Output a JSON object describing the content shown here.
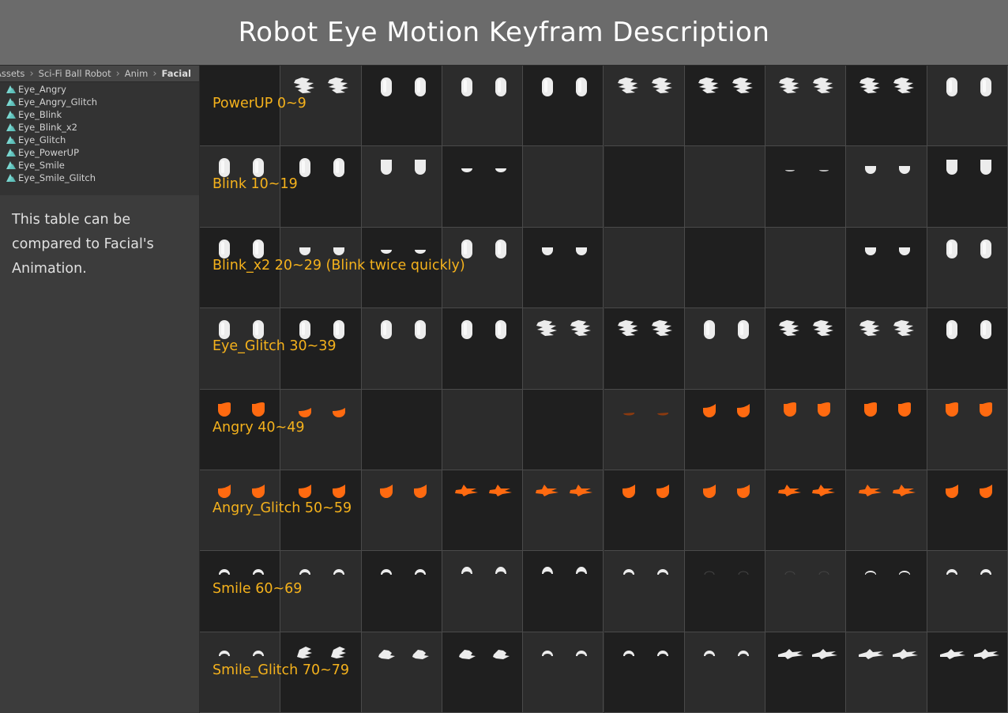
{
  "page": {
    "title": "Robot Eye Motion Keyfram Description"
  },
  "breadcrumb": [
    "Assets",
    "Sci-Fi Ball Robot",
    "Anim",
    "Facial"
  ],
  "files": [
    {
      "name": "Eye_Angry",
      "icon": "animation-clip-icon"
    },
    {
      "name": "Eye_Angry_Glitch",
      "icon": "animation-clip-icon"
    },
    {
      "name": "Eye_Blink",
      "icon": "animation-clip-icon"
    },
    {
      "name": "Eye_Blink_x2",
      "icon": "animation-clip-icon"
    },
    {
      "name": "Eye_Glitch",
      "icon": "animation-clip-icon"
    },
    {
      "name": "Eye_PowerUP",
      "icon": "animation-clip-icon"
    },
    {
      "name": "Eye_Smile",
      "icon": "animation-clip-icon"
    },
    {
      "name": "Eye_Smile_Glitch",
      "icon": "animation-clip-icon"
    }
  ],
  "note": "This table can be compared to Facial's Animation.",
  "colors": {
    "label": "#f5b21c",
    "eye_white": "#ececec",
    "eye_orange": "#ff6a10",
    "cell_dark": "#1f1f1f",
    "cell_light": "#2c2c2c",
    "title_bg": "#6b6b6b"
  },
  "rows": [
    {
      "label": "PowerUP 0~9",
      "frames": [
        "none",
        "glitch",
        "pill",
        "pill",
        "pill",
        "glitch",
        "glitch",
        "glitch",
        "glitch",
        "pill"
      ]
    },
    {
      "label": "Blink 10~19",
      "frames": [
        "pill",
        "pill",
        "pill_half",
        "slit",
        "none",
        "none",
        "none",
        "slit_thin",
        "pill_low",
        "pill_half"
      ]
    },
    {
      "label": "Blink_x2 20~29 (Blink twice quickly)",
      "frames": [
        "pill",
        "pill_low",
        "slit",
        "pill",
        "pill_low",
        "none",
        "none",
        "none",
        "pill_low",
        "pill"
      ]
    },
    {
      "label": "Eye_Glitch 30~39",
      "frames": [
        "pill",
        "pill",
        "pill",
        "pill",
        "glitch",
        "glitch",
        "pill",
        "glitch",
        "glitch",
        "pill"
      ]
    },
    {
      "label": "Angry 40~49",
      "frames": [
        "angry",
        "angry_low",
        "none",
        "none",
        "none",
        "angry_slit",
        "angry_mid",
        "angry",
        "angry",
        "angry"
      ]
    },
    {
      "label": "Angry_Glitch 50~59",
      "frames": [
        "angry_mid",
        "angry_mid",
        "angry_mid",
        "angry_glitch",
        "angry_glitch",
        "angry_mid",
        "angry_mid",
        "angry_glitch",
        "angry_glitch",
        "angry_mid"
      ]
    },
    {
      "label": "Smile 60~69",
      "frames": [
        "smile",
        "smile",
        "smile",
        "smile_big",
        "smile_big",
        "smile",
        "smile_faint",
        "smile_faint",
        "smile_thin",
        "smile"
      ]
    },
    {
      "label": "Smile_Glitch 70~79",
      "frames": [
        "smile",
        "smile_glitch",
        "glitch_small",
        "glitch_small",
        "smile",
        "smile",
        "smile",
        "glitch_wide",
        "glitch_wide",
        "glitch_wide"
      ]
    }
  ]
}
